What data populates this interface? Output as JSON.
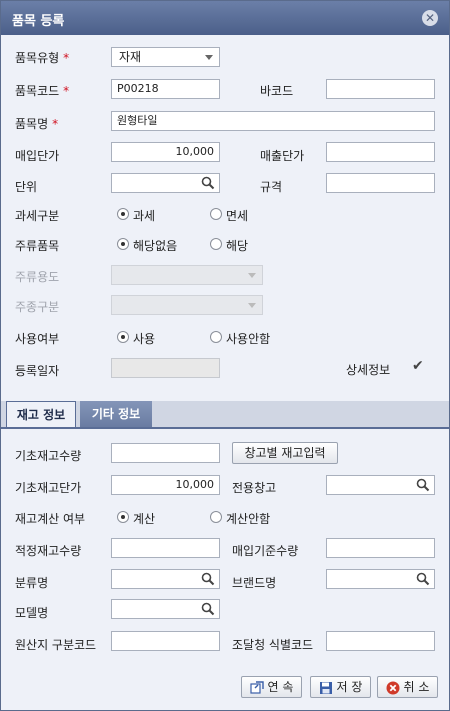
{
  "dialog": {
    "title": "품목 등록",
    "close_glyph": "✕"
  },
  "form": {
    "item_type": {
      "label": "품목유형",
      "value": "자재"
    },
    "item_code": {
      "label": "품목코드",
      "value": "P00218"
    },
    "barcode": {
      "label": "바코드",
      "value": ""
    },
    "item_name": {
      "label": "품목명",
      "value": "원형타일"
    },
    "purchase_price": {
      "label": "매입단가",
      "value": "10,000"
    },
    "sale_price": {
      "label": "매출단가",
      "value": ""
    },
    "unit": {
      "label": "단위",
      "value": ""
    },
    "spec": {
      "label": "규격",
      "value": ""
    },
    "tax_type": {
      "label": "과세구분",
      "options": [
        "과세",
        "면세"
      ],
      "selected": 0
    },
    "liquor": {
      "label": "주류품목",
      "options": [
        "해당없음",
        "해당"
      ],
      "selected": 0
    },
    "liquor_use": {
      "label": "주류용도"
    },
    "liquor_kind": {
      "label": "주종구분"
    },
    "use_yn": {
      "label": "사용여부",
      "options": [
        "사용",
        "사용안함"
      ],
      "selected": 0
    },
    "reg_date": {
      "label": "등록일자"
    },
    "detail_info": {
      "label": "상세정보",
      "checked": true
    }
  },
  "tabs": [
    {
      "label": "재고 정보",
      "active": true
    },
    {
      "label": "기타 정보",
      "active": false
    }
  ],
  "stock": {
    "base_qty": {
      "label": "기초재고수량",
      "value": ""
    },
    "warehouse_btn": "창고별 재고입력",
    "base_price": {
      "label": "기초재고단가",
      "value": "10,000"
    },
    "warehouse": {
      "label": "전용창고",
      "value": ""
    },
    "calc": {
      "label": "재고계산 여부",
      "options": [
        "계산",
        "계산안함"
      ],
      "selected": 0
    },
    "proper_qty": {
      "label": "적정재고수량",
      "value": ""
    },
    "purchase_base_qty": {
      "label": "매입기준수량",
      "value": ""
    },
    "category": {
      "label": "분류명",
      "value": ""
    },
    "brand": {
      "label": "브랜드명",
      "value": ""
    },
    "model": {
      "label": "모델명",
      "value": ""
    },
    "origin": {
      "label": "원산지 구분코드",
      "value": ""
    },
    "procurement": {
      "label": "조달청 식별코드",
      "value": ""
    }
  },
  "buttons": {
    "continue": "연 속",
    "save": "저 장",
    "cancel": "취 소"
  },
  "icons": {
    "search": "magnifier-icon",
    "continue": "continue-icon",
    "save": "floppy-icon",
    "cancel": "cancel-icon"
  },
  "colors": {
    "titlebar": "#4b5f89",
    "required": "#d0101f",
    "cancel_icon": "#d03a2a",
    "save_icon": "#3a5ea8"
  }
}
